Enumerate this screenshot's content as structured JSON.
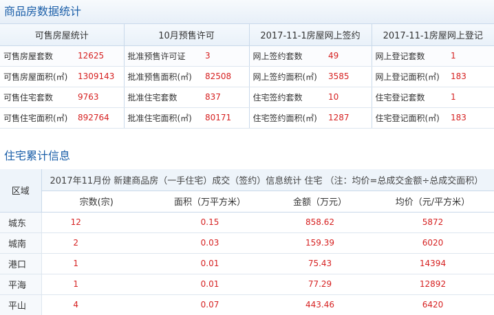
{
  "sections": {
    "stats_title": "商品房数据统计",
    "cumulative_title": "住宅累计信息"
  },
  "stats_table": {
    "headers": [
      "可售房屋统计",
      "10月预售许可",
      "2017-11-1房屋网上签约",
      "2017-11-1房屋网上登记"
    ],
    "rows": [
      [
        "可售房屋套数",
        "12625",
        "批准预售许可证",
        "3",
        "网上签约套数",
        "49",
        "网上登记套数",
        "1"
      ],
      [
        "可售房屋面积(㎡)",
        "1309143",
        "批准预售面积(㎡)",
        "82508",
        "网上签约面积(㎡)",
        "3585",
        "网上登记面积(㎡)",
        "183"
      ],
      [
        "可售住宅套数",
        "9763",
        "批准住宅套数",
        "837",
        "住宅签约套数",
        "10",
        "住宅登记套数",
        "1"
      ],
      [
        "可售住宅面积(㎡)",
        "892764",
        "批准住宅面积(㎡)",
        "80171",
        "住宅签约面积(㎡)",
        "1287",
        "住宅登记面积(㎡)",
        "183"
      ]
    ]
  },
  "cumulative_table": {
    "region_header": "区域",
    "caption": "2017年11月份 新建商品房（一手住宅）成交（签约）信息统计 住宅  （注：均价=总成交金额÷总成交面积）",
    "columns": [
      "宗数(宗)",
      "面积（万平方米）",
      "金额（万元）",
      "均价（元/平方米）"
    ],
    "rows": [
      [
        "城东",
        "12",
        "0.15",
        "858.62",
        "5872"
      ],
      [
        "城南",
        "2",
        "0.03",
        "159.39",
        "6020"
      ],
      [
        "港口",
        "1",
        "0.01",
        "75.43",
        "14394"
      ],
      [
        "平海",
        "1",
        "0.01",
        "77.29",
        "12892"
      ],
      [
        "平山",
        "4",
        "0.07",
        "443.46",
        "6420"
      ]
    ]
  },
  "colors": {
    "accent_blue": "#1a5ea8",
    "value_red": "#d62020",
    "header_bg": "#eef4fa",
    "border": "#c9d9ea"
  }
}
